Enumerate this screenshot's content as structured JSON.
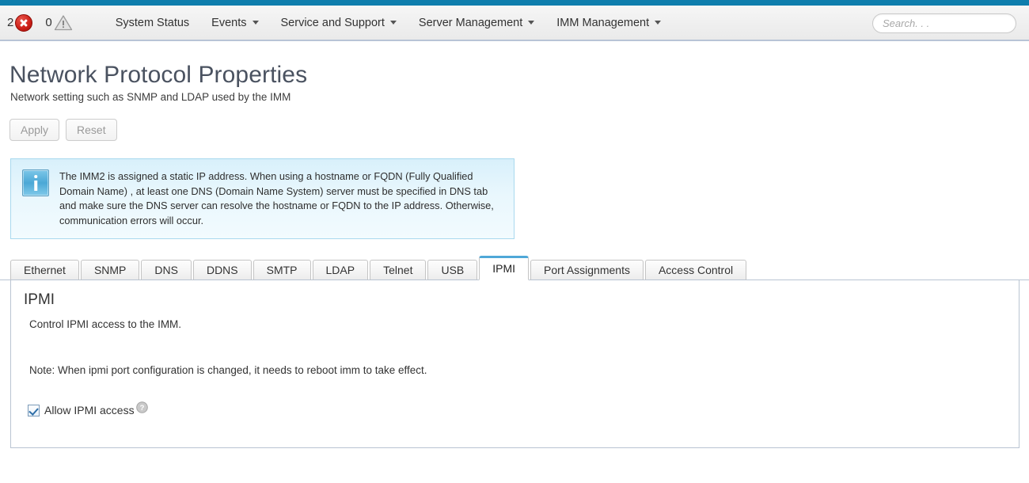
{
  "header": {
    "status": [
      {
        "count": "2",
        "icon": "error-circle-icon",
        "name": "critical-errors"
      },
      {
        "count": "0",
        "icon": "warning-triangle-icon",
        "name": "warnings"
      }
    ],
    "nav": [
      {
        "label": "System Status",
        "has_menu": false
      },
      {
        "label": "Events",
        "has_menu": true
      },
      {
        "label": "Service and Support",
        "has_menu": true
      },
      {
        "label": "Server Management",
        "has_menu": true
      },
      {
        "label": "IMM Management",
        "has_menu": true
      }
    ],
    "search": {
      "placeholder": "Search. . .",
      "value": "",
      "icon": "search-icon"
    },
    "accent_color": "#0e7ead"
  },
  "page": {
    "title": "Network Protocol Properties",
    "subtitle": "Network setting such as SNMP and LDAP used by the IMM"
  },
  "actions": {
    "apply_label": "Apply",
    "reset_label": "Reset"
  },
  "notice": {
    "icon": "info-icon",
    "text": "The IMM2 is assigned a static IP address. When using a hostname or FQDN (Fully Qualified Domain Name) , at least one DNS (Domain Name System) server must be specified in DNS tab and make sure the DNS server can resolve the hostname or FQDN to the IP address. Otherwise, communication errors will occur.",
    "background_color": "#e3f4fc",
    "border_color": "#a9d9ee"
  },
  "tabs": [
    {
      "label": "Ethernet",
      "active": false
    },
    {
      "label": "SNMP",
      "active": false
    },
    {
      "label": "DNS",
      "active": false
    },
    {
      "label": "DDNS",
      "active": false
    },
    {
      "label": "SMTP",
      "active": false
    },
    {
      "label": "LDAP",
      "active": false
    },
    {
      "label": "Telnet",
      "active": false
    },
    {
      "label": "USB",
      "active": false
    },
    {
      "label": "IPMI",
      "active": true
    },
    {
      "label": "Port Assignments",
      "active": false
    },
    {
      "label": "Access Control",
      "active": false
    }
  ],
  "panel": {
    "title": "IPMI",
    "description": "Control IPMI access to the IMM.",
    "note": "Note: When ipmi port configuration is changed, it needs to reboot imm to take effect.",
    "checkbox": {
      "label": "Allow IPMI access",
      "checked": true,
      "help_icon": "help-question-icon"
    }
  }
}
